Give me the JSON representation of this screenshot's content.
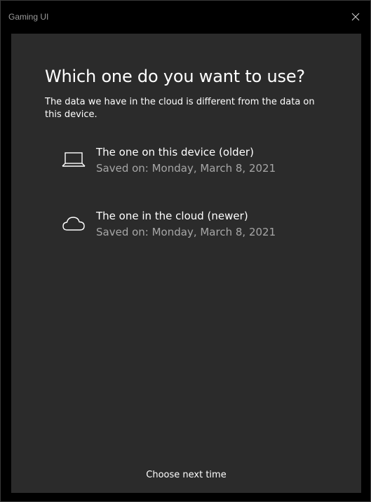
{
  "window": {
    "title": "Gaming UI"
  },
  "dialog": {
    "heading": "Which one do you want to use?",
    "description": "The data we have in the cloud is different from the data on this device.",
    "options": [
      {
        "icon": "laptop-icon",
        "title": "The one on this device (older)",
        "saved": "Saved on: Monday, March 8, 2021"
      },
      {
        "icon": "cloud-icon",
        "title": "The one in the cloud (newer)",
        "saved": "Saved on: Monday, March 8, 2021"
      }
    ],
    "choose_next_time": "Choose next time"
  },
  "colors": {
    "background": "#000000",
    "panel": "#2b2b2b",
    "text": "#ffffff",
    "secondary_text": "#a6a6a6",
    "title_text": "#9a9a9a"
  }
}
